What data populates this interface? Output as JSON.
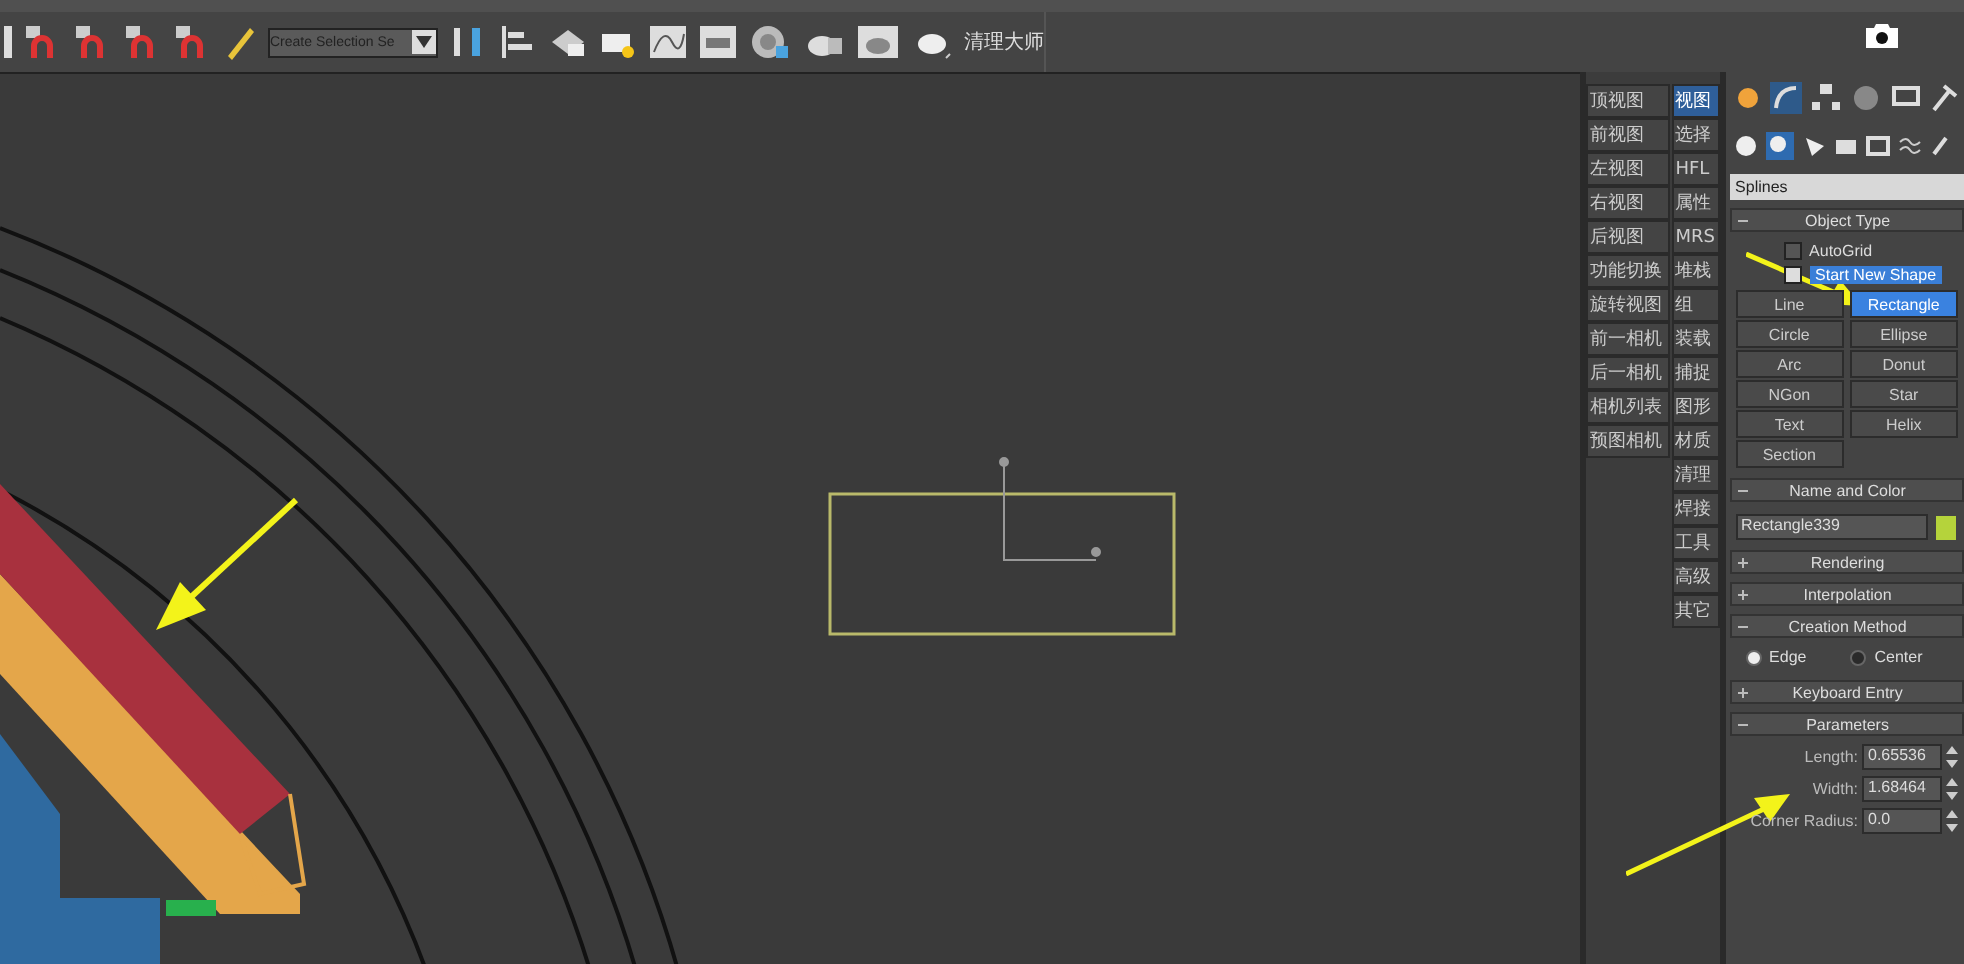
{
  "toolbar": {
    "selection_set": {
      "placeholder": "Create Selection Se"
    },
    "plugin_label": "清理大师"
  },
  "quick_panel": {
    "column_1": [
      {
        "label": "顶视图"
      },
      {
        "label": "前视图"
      },
      {
        "label": "左视图"
      },
      {
        "label": "右视图"
      },
      {
        "label": "后视图"
      },
      {
        "label": "功能切换"
      },
      {
        "label": "旋转视图"
      },
      {
        "label": "前一相机"
      },
      {
        "label": "后一相机"
      },
      {
        "label": "相机列表"
      },
      {
        "label": "预图相机"
      }
    ],
    "column_2": [
      {
        "label": "视图",
        "selected": true
      },
      {
        "label": "选择",
        "selected": false
      },
      {
        "label": "HFL",
        "selected": false
      },
      {
        "label": "属性",
        "selected": false
      },
      {
        "label": "MRS",
        "selected": false
      },
      {
        "label": "堆栈",
        "selected": false
      },
      {
        "label": "组",
        "selected": false
      },
      {
        "label": "装载",
        "selected": false
      },
      {
        "label": "捕捉",
        "selected": false
      },
      {
        "label": "图形",
        "selected": false
      },
      {
        "label": "材质",
        "selected": false
      },
      {
        "label": "清理",
        "selected": false
      },
      {
        "label": "焊接",
        "selected": false
      },
      {
        "label": "工具",
        "selected": false
      },
      {
        "label": "高级",
        "selected": false
      },
      {
        "label": "其它",
        "selected": false
      }
    ]
  },
  "command_panel": {
    "category": "Splines",
    "rollouts": [
      {
        "kind": "object_type",
        "title": "Object Type",
        "expanded": true,
        "options": [
          {
            "label": "AutoGrid",
            "checked": false
          },
          {
            "label": "Start New Shape",
            "checked": true
          }
        ],
        "buttons": [
          {
            "label": "Line",
            "selected": false
          },
          {
            "label": "Rectangle",
            "selected": true
          },
          {
            "label": "Circle",
            "selected": false
          },
          {
            "label": "Ellipse",
            "selected": false
          },
          {
            "label": "Arc",
            "selected": false
          },
          {
            "label": "Donut",
            "selected": false
          },
          {
            "label": "NGon",
            "selected": false
          },
          {
            "label": "Star",
            "selected": false
          },
          {
            "label": "Text",
            "selected": false
          },
          {
            "label": "Helix",
            "selected": false
          },
          {
            "label": "Section",
            "selected": false
          }
        ]
      },
      {
        "kind": "name_color",
        "title": "Name and Color",
        "expanded": true,
        "name": "Rectangle339",
        "color": "#b5d33b"
      },
      {
        "title": "Rendering",
        "expanded": false
      },
      {
        "title": "Interpolation",
        "expanded": false
      },
      {
        "kind": "radios",
        "title": "Creation Method",
        "expanded": true,
        "options": [
          {
            "label": "Edge",
            "selected": true
          },
          {
            "label": "Center",
            "selected": false
          }
        ]
      },
      {
        "title": "Keyboard Entry",
        "expanded": false
      },
      {
        "kind": "params",
        "title": "Parameters",
        "expanded": true,
        "fields": [
          {
            "label": "Length:",
            "value": "0.65536"
          },
          {
            "label": "Width:",
            "value": "1.68464"
          },
          {
            "label": "Corner Radius:",
            "value": "0.0"
          }
        ]
      }
    ]
  }
}
